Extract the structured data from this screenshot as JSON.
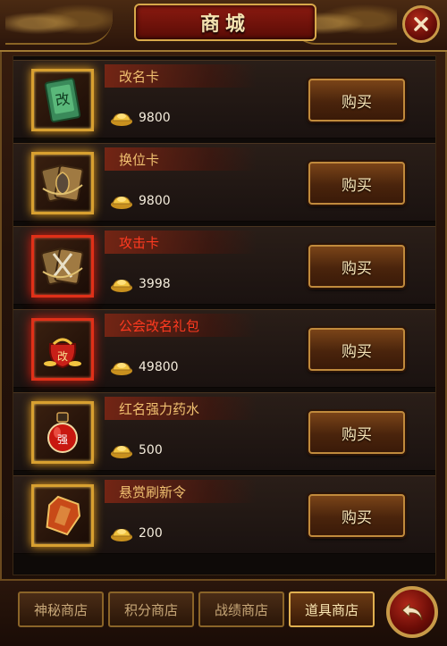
{
  "header": {
    "title": "商城"
  },
  "items": [
    {
      "name": "改名卡",
      "price": "9800",
      "buy_label": "购买",
      "icon": "rename-card-icon",
      "highlight": "gold"
    },
    {
      "name": "换位卡",
      "price": "9800",
      "buy_label": "购买",
      "icon": "swap-card-icon",
      "highlight": "gold"
    },
    {
      "name": "攻击卡",
      "price": "3998",
      "buy_label": "购买",
      "icon": "attack-card-icon",
      "highlight": "red"
    },
    {
      "name": "公会改名礼包",
      "price": "49800",
      "buy_label": "购买",
      "icon": "guild-rename-pack-icon",
      "highlight": "red"
    },
    {
      "name": "红名强力药水",
      "price": "500",
      "buy_label": "购买",
      "icon": "red-potion-icon",
      "highlight": "gold"
    },
    {
      "name": "悬赏刷新令",
      "price": "200",
      "buy_label": "购买",
      "icon": "bounty-token-icon",
      "highlight": "gold"
    }
  ],
  "currency_icon": "gold-ingot-icon",
  "tabs": [
    {
      "label": "神秘商店",
      "active": false
    },
    {
      "label": "积分商店",
      "active": false
    },
    {
      "label": "战绩商店",
      "active": false
    },
    {
      "label": "道具商店",
      "active": true
    }
  ],
  "colors": {
    "name_gold": "#f0c070",
    "name_red": "#ff3a20",
    "frame_gold": "#d8a030",
    "frame_red": "#e03018"
  }
}
